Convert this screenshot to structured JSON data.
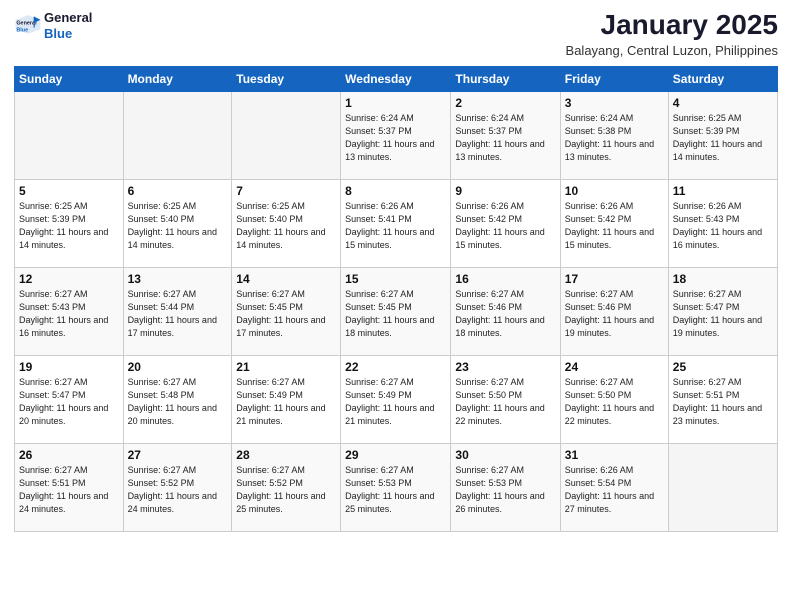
{
  "header": {
    "logo_general": "General",
    "logo_blue": "Blue",
    "month_year": "January 2025",
    "location": "Balayang, Central Luzon, Philippines"
  },
  "weekdays": [
    "Sunday",
    "Monday",
    "Tuesday",
    "Wednesday",
    "Thursday",
    "Friday",
    "Saturday"
  ],
  "weeks": [
    [
      {
        "day": "",
        "sunrise": "",
        "sunset": "",
        "daylight": ""
      },
      {
        "day": "",
        "sunrise": "",
        "sunset": "",
        "daylight": ""
      },
      {
        "day": "",
        "sunrise": "",
        "sunset": "",
        "daylight": ""
      },
      {
        "day": "1",
        "sunrise": "6:24 AM",
        "sunset": "5:37 PM",
        "daylight": "11 hours and 13 minutes."
      },
      {
        "day": "2",
        "sunrise": "6:24 AM",
        "sunset": "5:37 PM",
        "daylight": "11 hours and 13 minutes."
      },
      {
        "day": "3",
        "sunrise": "6:24 AM",
        "sunset": "5:38 PM",
        "daylight": "11 hours and 13 minutes."
      },
      {
        "day": "4",
        "sunrise": "6:25 AM",
        "sunset": "5:39 PM",
        "daylight": "11 hours and 14 minutes."
      }
    ],
    [
      {
        "day": "5",
        "sunrise": "6:25 AM",
        "sunset": "5:39 PM",
        "daylight": "11 hours and 14 minutes."
      },
      {
        "day": "6",
        "sunrise": "6:25 AM",
        "sunset": "5:40 PM",
        "daylight": "11 hours and 14 minutes."
      },
      {
        "day": "7",
        "sunrise": "6:25 AM",
        "sunset": "5:40 PM",
        "daylight": "11 hours and 14 minutes."
      },
      {
        "day": "8",
        "sunrise": "6:26 AM",
        "sunset": "5:41 PM",
        "daylight": "11 hours and 15 minutes."
      },
      {
        "day": "9",
        "sunrise": "6:26 AM",
        "sunset": "5:42 PM",
        "daylight": "11 hours and 15 minutes."
      },
      {
        "day": "10",
        "sunrise": "6:26 AM",
        "sunset": "5:42 PM",
        "daylight": "11 hours and 15 minutes."
      },
      {
        "day": "11",
        "sunrise": "6:26 AM",
        "sunset": "5:43 PM",
        "daylight": "11 hours and 16 minutes."
      }
    ],
    [
      {
        "day": "12",
        "sunrise": "6:27 AM",
        "sunset": "5:43 PM",
        "daylight": "11 hours and 16 minutes."
      },
      {
        "day": "13",
        "sunrise": "6:27 AM",
        "sunset": "5:44 PM",
        "daylight": "11 hours and 17 minutes."
      },
      {
        "day": "14",
        "sunrise": "6:27 AM",
        "sunset": "5:45 PM",
        "daylight": "11 hours and 17 minutes."
      },
      {
        "day": "15",
        "sunrise": "6:27 AM",
        "sunset": "5:45 PM",
        "daylight": "11 hours and 18 minutes."
      },
      {
        "day": "16",
        "sunrise": "6:27 AM",
        "sunset": "5:46 PM",
        "daylight": "11 hours and 18 minutes."
      },
      {
        "day": "17",
        "sunrise": "6:27 AM",
        "sunset": "5:46 PM",
        "daylight": "11 hours and 19 minutes."
      },
      {
        "day": "18",
        "sunrise": "6:27 AM",
        "sunset": "5:47 PM",
        "daylight": "11 hours and 19 minutes."
      }
    ],
    [
      {
        "day": "19",
        "sunrise": "6:27 AM",
        "sunset": "5:47 PM",
        "daylight": "11 hours and 20 minutes."
      },
      {
        "day": "20",
        "sunrise": "6:27 AM",
        "sunset": "5:48 PM",
        "daylight": "11 hours and 20 minutes."
      },
      {
        "day": "21",
        "sunrise": "6:27 AM",
        "sunset": "5:49 PM",
        "daylight": "11 hours and 21 minutes."
      },
      {
        "day": "22",
        "sunrise": "6:27 AM",
        "sunset": "5:49 PM",
        "daylight": "11 hours and 21 minutes."
      },
      {
        "day": "23",
        "sunrise": "6:27 AM",
        "sunset": "5:50 PM",
        "daylight": "11 hours and 22 minutes."
      },
      {
        "day": "24",
        "sunrise": "6:27 AM",
        "sunset": "5:50 PM",
        "daylight": "11 hours and 22 minutes."
      },
      {
        "day": "25",
        "sunrise": "6:27 AM",
        "sunset": "5:51 PM",
        "daylight": "11 hours and 23 minutes."
      }
    ],
    [
      {
        "day": "26",
        "sunrise": "6:27 AM",
        "sunset": "5:51 PM",
        "daylight": "11 hours and 24 minutes."
      },
      {
        "day": "27",
        "sunrise": "6:27 AM",
        "sunset": "5:52 PM",
        "daylight": "11 hours and 24 minutes."
      },
      {
        "day": "28",
        "sunrise": "6:27 AM",
        "sunset": "5:52 PM",
        "daylight": "11 hours and 25 minutes."
      },
      {
        "day": "29",
        "sunrise": "6:27 AM",
        "sunset": "5:53 PM",
        "daylight": "11 hours and 25 minutes."
      },
      {
        "day": "30",
        "sunrise": "6:27 AM",
        "sunset": "5:53 PM",
        "daylight": "11 hours and 26 minutes."
      },
      {
        "day": "31",
        "sunrise": "6:26 AM",
        "sunset": "5:54 PM",
        "daylight": "11 hours and 27 minutes."
      },
      {
        "day": "",
        "sunrise": "",
        "sunset": "",
        "daylight": ""
      }
    ]
  ]
}
